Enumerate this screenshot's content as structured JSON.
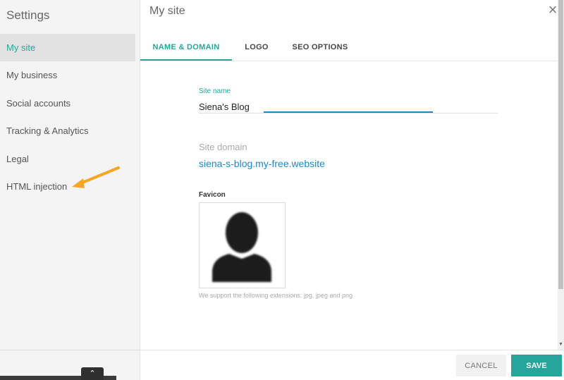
{
  "sidebar": {
    "title": "Settings",
    "items": [
      {
        "label": "My site"
      },
      {
        "label": "My business"
      },
      {
        "label": "Social accounts"
      },
      {
        "label": "Tracking & Analytics"
      },
      {
        "label": "Legal"
      },
      {
        "label": "HTML injection"
      }
    ],
    "expand_icon": "chevron-up-icon"
  },
  "dialog": {
    "title": "My site",
    "close_icon": "close-icon",
    "tabs": [
      {
        "label": "NAME & DOMAIN",
        "active": true
      },
      {
        "label": "LOGO"
      },
      {
        "label": "SEO OPTIONS"
      }
    ]
  },
  "form": {
    "site_name_label": "Site name",
    "site_name_value": "Siena's Blog",
    "site_domain_label": "Site domain",
    "site_domain_value": "siena-s-blog.my-free.website",
    "favicon_label": "Favicon",
    "favicon_help": "We support the following extensions: jpg, jpeg and png"
  },
  "footer": {
    "cancel_label": "CANCEL",
    "save_label": "SAVE"
  },
  "colors": {
    "accent": "#26a69a",
    "link": "#1e88c7",
    "annotation_arrow": "#f5a623"
  }
}
